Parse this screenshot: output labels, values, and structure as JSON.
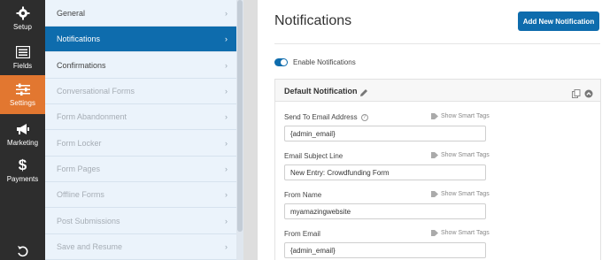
{
  "rail": {
    "items": [
      {
        "label": "Setup",
        "icon": "gear-icon"
      },
      {
        "label": "Fields",
        "icon": "fields-icon"
      },
      {
        "label": "Settings",
        "icon": "sliders-icon"
      },
      {
        "label": "Marketing",
        "icon": "megaphone-icon"
      },
      {
        "label": "Payments",
        "icon": "dollar-icon"
      }
    ],
    "bottom_icon": "undo-icon",
    "active_color": "#e27730"
  },
  "submenu": {
    "items": [
      {
        "label": "General",
        "state": "normal"
      },
      {
        "label": "Notifications",
        "state": "active"
      },
      {
        "label": "Confirmations",
        "state": "normal"
      },
      {
        "label": "Conversational Forms",
        "state": "disabled"
      },
      {
        "label": "Form Abandonment",
        "state": "disabled"
      },
      {
        "label": "Form Locker",
        "state": "disabled"
      },
      {
        "label": "Form Pages",
        "state": "disabled"
      },
      {
        "label": "Offline Forms",
        "state": "disabled"
      },
      {
        "label": "Post Submissions",
        "state": "disabled"
      },
      {
        "label": "Save and Resume",
        "state": "disabled"
      }
    ],
    "chevron": "›"
  },
  "main": {
    "title": "Notifications",
    "add_button": "Add New Notification",
    "toggle_label": "Enable Notifications",
    "toggle_on": true,
    "card": {
      "title": "Default Notification",
      "smart_tags_label": "Show Smart Tags",
      "fields": [
        {
          "label": "Send To Email Address",
          "value": "{admin_email}",
          "help": true
        },
        {
          "label": "Email Subject Line",
          "value": "New Entry: Crowdfunding Form",
          "help": false
        },
        {
          "label": "From Name",
          "value": "myamazingwebsite",
          "help": false
        },
        {
          "label": "From Email",
          "value": "{admin_email}",
          "help": false
        }
      ]
    }
  },
  "colors": {
    "primary": "#0e6cad",
    "accent": "#e27730"
  }
}
